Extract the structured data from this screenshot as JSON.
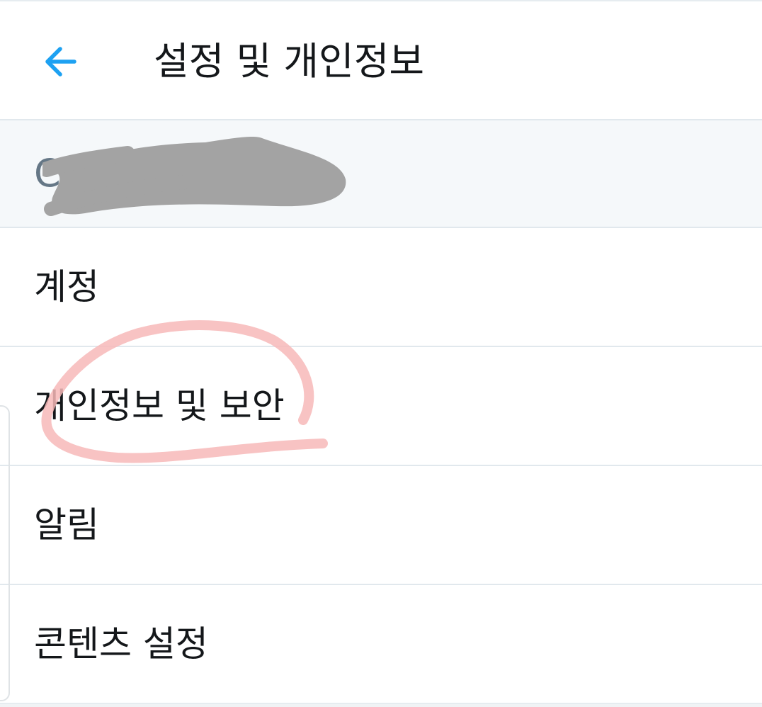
{
  "header": {
    "title": "설정 및 개인정보",
    "back_icon": "arrow-left-icon",
    "accent_color": "#1da1f2"
  },
  "account": {
    "handle_visible": "C",
    "redacted": true
  },
  "menu": {
    "items": [
      {
        "label": "계정"
      },
      {
        "label": "개인정보 및 보안",
        "highlighted": true
      },
      {
        "label": "알림"
      },
      {
        "label": "콘텐츠 설정"
      }
    ]
  },
  "colors": {
    "text_primary": "#14171a",
    "text_secondary": "#657786",
    "divider": "#e1e8ed",
    "account_row_bg": "#f5f8fa",
    "redaction": "#a3a3a3",
    "annotation": "#f7b8b8"
  }
}
